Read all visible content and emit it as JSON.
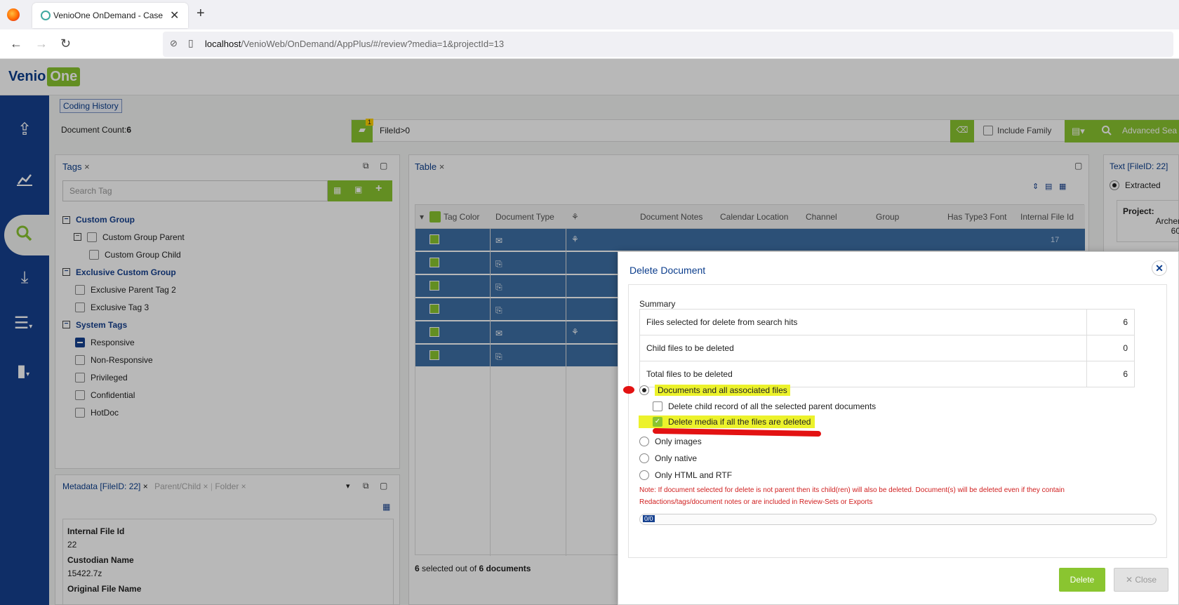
{
  "browser": {
    "tab_title": "VenioOne OnDemand - Case",
    "url_host": "localhost",
    "url_path": "/VenioWeb/OnDemand/AppPlus/#/review?media=1&projectId=13"
  },
  "app": {
    "brand_a": "Venio",
    "brand_b": "One",
    "coding_history": "Coding History",
    "doc_count_label": "Document Count:",
    "doc_count_value": "6",
    "folder_badge": "1",
    "search_query": "FileId>0",
    "include_family": "Include Family",
    "advanced_search": "Advanced Sea"
  },
  "tags_panel": {
    "title": "Tags",
    "search_placeholder": "Search Tag",
    "groups": [
      {
        "name": "Custom Group",
        "items": [
          "Custom Group Parent",
          "Custom Group Child"
        ]
      },
      {
        "name": "Exclusive Custom Group",
        "items": [
          "Exclusive Parent Tag 2",
          "Exclusive Tag 3"
        ]
      },
      {
        "name": "System Tags",
        "items": [
          "Responsive",
          "Non-Responsive",
          "Privileged",
          "Confidential",
          "HotDoc"
        ]
      }
    ]
  },
  "meta_panel": {
    "tab1": "Metadata [FileID: 22]",
    "tab2": "Parent/Child",
    "tab3": "Folder",
    "fields": [
      {
        "label": "Internal File Id",
        "value": "22"
      },
      {
        "label": "Custodian Name",
        "value": "15422.7z"
      },
      {
        "label": "Original File Name",
        "value": ""
      }
    ]
  },
  "table_panel": {
    "title": "Table",
    "columns": [
      "Tag Color",
      "Document Type",
      "",
      "Document Notes",
      "Calendar Location",
      "Channel",
      "Group",
      "Has Type3 Font",
      "Internal File Id"
    ],
    "first_row_file_id": "17",
    "sel_count": "6",
    "sel_mid": "selected out of",
    "sel_total": "6 documents"
  },
  "text_panel": {
    "title": "Text [FileID: 22]",
    "radio": "Extracted",
    "project_label": "Project:",
    "project_value": "Archer",
    "project_value2": "60"
  },
  "modal": {
    "title": "Delete Document",
    "summary_label": "Summary",
    "rows": [
      {
        "label": "Files selected for delete from search hits",
        "value": "6"
      },
      {
        "label": "Child files to be deleted",
        "value": "0"
      },
      {
        "label": "Total files to be deleted",
        "value": "6"
      }
    ],
    "opt_all": "Documents and all associated files",
    "opt_child": "Delete child record of all the selected parent documents",
    "opt_media": "Delete media if all the files are deleted",
    "opt_images": "Only images",
    "opt_native": "Only native",
    "opt_html": "Only HTML and RTF",
    "note": "Note: If document selected for delete is not parent then its child(ren) will also be deleted. Document(s) will be deleted even if they contain Redactions/tags/document notes or are included in Review-Sets or Exports",
    "progress_text": "0/0",
    "delete_label": "Delete",
    "close_label": "Close"
  }
}
